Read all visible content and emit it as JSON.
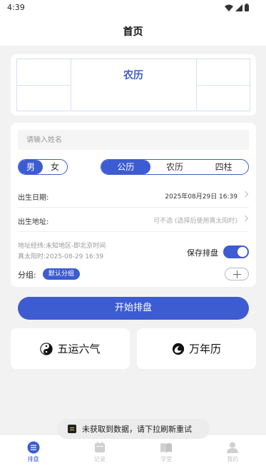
{
  "status_bar": {
    "time": "4:39"
  },
  "header": {
    "title": "首页"
  },
  "calendar": {
    "title": "农历"
  },
  "form": {
    "name_placeholder": "请输入姓名",
    "gender": {
      "options": [
        "男",
        "女"
      ],
      "selected": "男"
    },
    "calendar_type": {
      "options": [
        "公历",
        "农历",
        "四柱"
      ],
      "selected": "公历"
    },
    "birth_date": {
      "label": "出生日期:",
      "value": "2025年08月29日 16:39"
    },
    "birth_place": {
      "label": "出生地址:",
      "value": "可不选 (选择后使用真太阳时)"
    },
    "address_info": "地址经纬:未知地区-即北京时间",
    "true_solar_time": "真太阳时:2025-08-29 16:39",
    "save_label": "保存排盘",
    "save_enabled": true,
    "group_label": "分组:",
    "group_value": "默认分组"
  },
  "start_button": "开始排盘",
  "features": [
    {
      "label": "五运六气",
      "icon": "yin-yang-icon"
    },
    {
      "label": "万年历",
      "icon": "swirl-icon"
    }
  ],
  "toast": "未获取到数据，请下拉刷新重试",
  "tabbar": {
    "items": [
      {
        "label": "排盘",
        "icon": "list-icon",
        "active": true
      },
      {
        "label": "记录",
        "icon": "calendar-icon",
        "active": false
      },
      {
        "label": "学堂",
        "icon": "book-icon",
        "active": false
      },
      {
        "label": "我的",
        "icon": "user-icon",
        "active": false
      }
    ]
  },
  "colors": {
    "primary": "#3d5cd1",
    "background": "#f2f2f2"
  }
}
